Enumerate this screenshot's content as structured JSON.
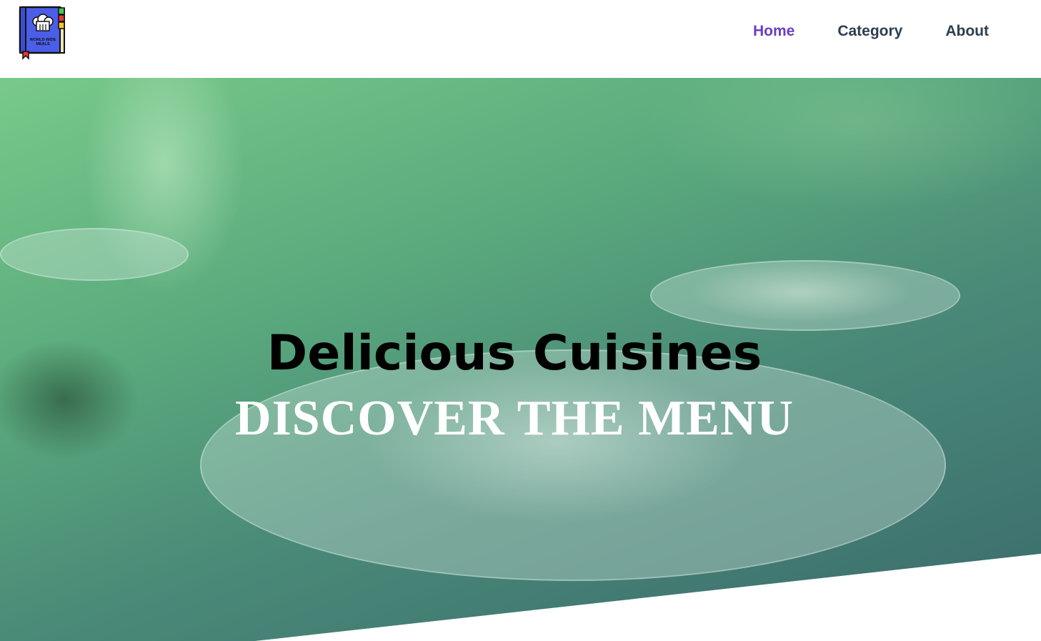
{
  "brand": {
    "logo_icon": "chef-hat-book-icon",
    "logo_text_line1": "WORLD WIDE",
    "logo_text_line2": "MEALS"
  },
  "nav": {
    "items": [
      {
        "label": "Home",
        "active": true
      },
      {
        "label": "Category",
        "active": false
      },
      {
        "label": "About",
        "active": false
      }
    ],
    "active_color": "#6a3fc0",
    "default_color": "#2c3e50"
  },
  "hero": {
    "subtitle": "Delicious Cuisines",
    "title": "DISCOVER THE MENU",
    "overlay_colors": [
      "#78c98a",
      "#3a6a6c"
    ]
  }
}
